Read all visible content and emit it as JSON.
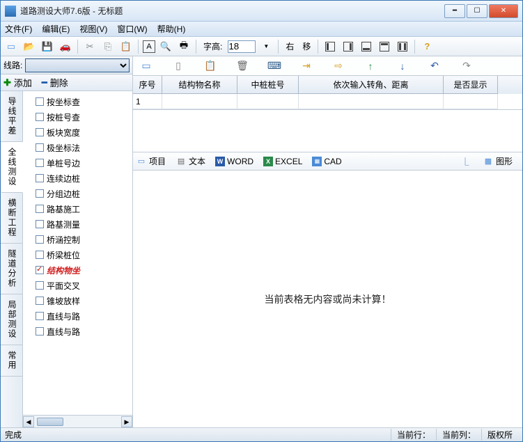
{
  "title": "道路测设大师7.6版 - 无标题",
  "menu": {
    "file": "文件(F)",
    "edit": "编辑(E)",
    "view": "视图(V)",
    "window": "窗口(W)",
    "help": "帮助(H)"
  },
  "toolbar": {
    "fontheight_label": "字高:",
    "fontheight_value": "18",
    "right_label": "右",
    "shift_label": "移"
  },
  "left": {
    "line_label": "线路:",
    "add_label": "添加",
    "remove_label": "删除",
    "vtabs": [
      "导线平差",
      "全线测设",
      "横断工程",
      "隧道分析",
      "局部测设",
      "常用"
    ],
    "active_vtab": 1,
    "tree": [
      {
        "label": "按坐标查",
        "checked": false
      },
      {
        "label": "按桩号查",
        "checked": false
      },
      {
        "label": "板块宽度",
        "checked": false
      },
      {
        "label": "极坐标法",
        "checked": false
      },
      {
        "label": "单桩号边",
        "checked": false
      },
      {
        "label": "连续边桩",
        "checked": false
      },
      {
        "label": "分组边桩",
        "checked": false
      },
      {
        "label": "路基施工",
        "checked": false
      },
      {
        "label": "路基测量",
        "checked": false
      },
      {
        "label": "桥涵控制",
        "checked": false
      },
      {
        "label": "桥梁桩位",
        "checked": false
      },
      {
        "label": "结构物坐",
        "checked": true,
        "active": true
      },
      {
        "label": "平面交叉",
        "checked": false
      },
      {
        "label": "锥坡放样",
        "checked": false
      },
      {
        "label": "直线与路",
        "checked": false
      },
      {
        "label": "直线与路",
        "checked": false
      }
    ]
  },
  "table": {
    "headers": [
      "序号",
      "结构物名称",
      "中桩桩号",
      "依次输入转角、距离",
      "是否显示"
    ],
    "rows": [
      {
        "seq": "1",
        "name": "",
        "pile": "",
        "inputs": "",
        "show": ""
      }
    ]
  },
  "preview": {
    "tabs": {
      "project": "项目",
      "text": "文本",
      "word": "WORD",
      "excel": "EXCEL",
      "cad": "CAD",
      "graph": "图形"
    },
    "empty_msg": "当前表格无内容或尚未计算！"
  },
  "status": {
    "ready": "完成",
    "row": "当前行：",
    "col": "当前列：",
    "copyright": "版权所"
  }
}
